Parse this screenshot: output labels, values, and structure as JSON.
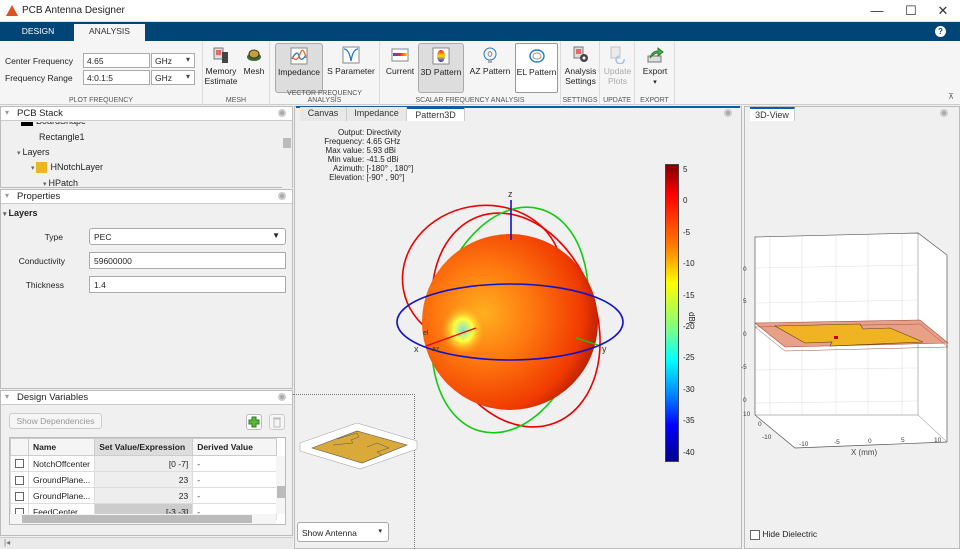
{
  "window": {
    "title": "PCB Antenna Designer",
    "minimize": "—",
    "maximize": "☐",
    "close": "✕"
  },
  "tabs": [
    {
      "label": "DESIGN"
    },
    {
      "label": "ANALYSIS",
      "active": true
    }
  ],
  "help_icon": "?",
  "ribbon": {
    "plot_frequency": {
      "label": "PLOT FREQUENCY",
      "center_frequency_label": "Center Frequency",
      "center_frequency_value": "4.65",
      "center_frequency_unit": "GHz",
      "frequency_range_label": "Frequency Range",
      "frequency_range_value": "4:0.1:5",
      "frequency_range_unit": "GHz"
    },
    "mesh": {
      "label": "MESH",
      "memory_estimate_1": "Memory",
      "memory_estimate_2": "Estimate",
      "mesh": "Mesh"
    },
    "vector": {
      "label": "VECTOR FREQUENCY ANALYSIS",
      "impedance": "Impedance",
      "s_parameter": "S Parameter"
    },
    "scalar": {
      "label": "SCALAR FREQUENCY ANALYSIS",
      "current": "Current",
      "pattern3d": "3D Pattern",
      "az_pattern": "AZ Pattern",
      "el_pattern": "EL Pattern"
    },
    "settings": {
      "label": "SETTINGS",
      "analysis_settings_1": "Analysis",
      "analysis_settings_2": "Settings"
    },
    "update": {
      "label": "UPDATE",
      "update_plots_1": "Update",
      "update_plots_2": "Plots"
    },
    "export": {
      "label": "EXPORT",
      "export": "Export"
    }
  },
  "pcb_stack": {
    "title": "PCB Stack",
    "items": [
      {
        "label": "BoardShape"
      },
      {
        "label": "Rectangle1"
      },
      {
        "label": "Layers"
      },
      {
        "label": "HNotchLayer",
        "color": "#f0b323"
      },
      {
        "label": "HPatch"
      }
    ]
  },
  "properties": {
    "title": "Properties",
    "section": "Layers",
    "type_label": "Type",
    "type_value": "PEC",
    "conductivity_label": "Conductivity",
    "conductivity_value": "59600000",
    "thickness_label": "Thickness",
    "thickness_value": "1.4"
  },
  "design_variables": {
    "title": "Design Variables",
    "show_dependencies": "Show Dependencies",
    "columns": [
      "Name",
      "Set Value/Expression",
      "Derived Value"
    ],
    "rows": [
      {
        "name": "NotchOffcenter",
        "value": "[0 -7]",
        "derived": "-"
      },
      {
        "name": "GroundPlane...",
        "value": "23",
        "derived": "-"
      },
      {
        "name": "GroundPlane...",
        "value": "23",
        "derived": "-"
      },
      {
        "name": "FeedCenter",
        "value": "[-3 -3]",
        "derived": "-"
      }
    ]
  },
  "doc_tabs": [
    {
      "label": "Canvas"
    },
    {
      "label": "Impedance"
    },
    {
      "label": "Pattern3D",
      "active": true
    }
  ],
  "pattern_info": {
    "output_k": "Output",
    "output_v": "Directivity",
    "frequency_k": "Frequency",
    "frequency_v": "4.65 GHz",
    "max_k": "Max value",
    "max_v": "5.93 dBi",
    "min_k": "Min value",
    "min_v": "-41.5 dBi",
    "azimuth_k": "Azimuth",
    "azimuth_v": "[-180° , 180°]",
    "elevation_k": "Elevation",
    "elevation_v": "[-90° , 90°]"
  },
  "pattern3d": {
    "axis_labels": {
      "x": "x",
      "y": "y",
      "z": "z",
      "el": "el",
      "az": "az"
    },
    "colorbar": {
      "label": "dBi",
      "ticks": [
        "5",
        "0",
        "-5",
        "-10",
        "-15",
        "-20",
        "-25",
        "-30",
        "-35",
        "-40"
      ],
      "min": -41.5,
      "max": 5.93
    }
  },
  "show_antenna": "Show Antenna",
  "view3d": {
    "tab": "3D-View",
    "xlabel": "X (mm)",
    "x_ticks": [
      "-10",
      "-5",
      "0",
      "5",
      "10"
    ],
    "y_ticks": [
      "10",
      "0",
      "-10"
    ],
    "z_ticks": [
      "0",
      "5",
      "0",
      "-5",
      "0"
    ],
    "hide_dielectric": "Hide Dielectric"
  }
}
